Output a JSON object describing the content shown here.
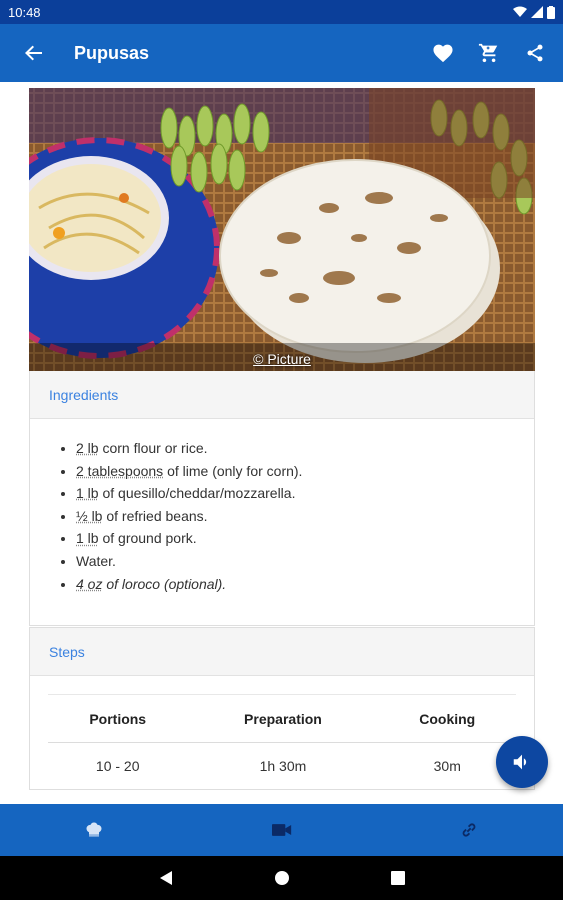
{
  "status_bar": {
    "time": "10:48"
  },
  "app_bar": {
    "title": "Pupusas",
    "back_icon": "arrow-back-icon",
    "actions": [
      "favorite-icon",
      "cart-icon",
      "share-icon"
    ]
  },
  "hero": {
    "credit": "© Picture"
  },
  "ingredients": {
    "header": "Ingredients",
    "items": [
      {
        "qty": "2 lb",
        "text": " corn flour or rice."
      },
      {
        "qty": "2 tablespoons",
        "text": " of lime (only for corn)."
      },
      {
        "qty": "1 lb",
        "text": " of quesillo/cheddar/mozzarella."
      },
      {
        "qty": "½ lb",
        "text": " of refried beans."
      },
      {
        "qty": "1 lb",
        "text": " of ground pork."
      },
      {
        "qty": "",
        "text": "Water."
      },
      {
        "qty": "4 oz",
        "text": " of loroco (optional)."
      }
    ]
  },
  "steps": {
    "header": "Steps",
    "columns": [
      "Portions",
      "Preparation",
      "Cooking"
    ],
    "values": [
      "10 - 20",
      "1h 30m",
      "30m"
    ]
  },
  "fab": {
    "icon": "volume-icon"
  },
  "bottom_nav": {
    "tabs": [
      "chef-hat-icon",
      "video-icon",
      "link-icon"
    ]
  },
  "colors": {
    "primary": "#1565c0",
    "status_bar": "#0b3f9a",
    "accent_text": "#3b82e0",
    "fab": "#0d47a1"
  }
}
